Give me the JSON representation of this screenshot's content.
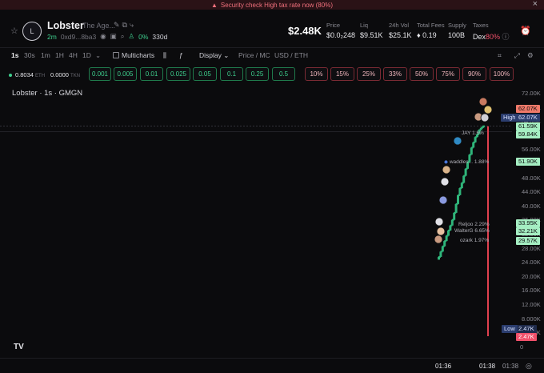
{
  "banner": {
    "text": "Security check High tax rate now (80%)",
    "close": "×"
  },
  "token": {
    "avatar_letter": "L",
    "name": "Lobster",
    "subtitle": "The Age...",
    "age": "2m",
    "address": "0xd9...8ba3",
    "holders_pct": "0%",
    "holders_count": "330d",
    "price_big": "$2.48K"
  },
  "stats": {
    "price": {
      "label": "Price",
      "value": "$0.0₂248"
    },
    "liq": {
      "label": "Liq",
      "value": "$9.51K"
    },
    "vol": {
      "label": "24h Vol",
      "value": "$25.1K"
    },
    "fees": {
      "label": "Total Fees",
      "value": "0.19"
    },
    "supply": {
      "label": "Supply",
      "value": "100B"
    },
    "taxes": {
      "label": "Taxes",
      "value_prefix": "Dex",
      "value_pct": "80%"
    }
  },
  "toolbar": {
    "intervals": [
      "1s",
      "30s",
      "1m",
      "1H",
      "4H",
      "1D"
    ],
    "multicharts": "Multicharts",
    "display": "Display",
    "price_mc": "Price / MC",
    "usd_eth": "USD / ETH"
  },
  "quick": {
    "eth_balance": "0.8034",
    "eth_unit": "ETH",
    "tkn_balance": "0.0000",
    "tkn_unit": "TKN",
    "buy": [
      "0.001",
      "0.005",
      "0.01",
      "0.025",
      "0.05",
      "0.1",
      "0.25",
      "0.5"
    ],
    "sell": [
      "10%",
      "15%",
      "25%",
      "33%",
      "50%",
      "75%",
      "90%",
      "100%"
    ]
  },
  "chart_data": {
    "type": "candlestick",
    "title": "Lobster · 1s · GMGN",
    "y_ticks": [
      "72.00K",
      "68.00K",
      "64.00K",
      "60.00K",
      "56.00K",
      "52.00K",
      "48.00K",
      "44.00K",
      "40.00K",
      "36.00K",
      "32.00K",
      "28.00K",
      "24.00K",
      "20.00K",
      "16.00K",
      "12.00K",
      "8.000K",
      "4.000K",
      "0"
    ],
    "price_tags": [
      {
        "value": "62.07K",
        "style": "o"
      },
      {
        "value": "62.07K",
        "style": "b"
      },
      {
        "value": "61.59K",
        "style": "g"
      },
      {
        "value": "59.84K",
        "style": "g"
      },
      {
        "value": "51.90K",
        "style": "g"
      },
      {
        "value": "33.95K",
        "style": "g"
      },
      {
        "value": "32.21K",
        "style": "g"
      },
      {
        "value": "29.57K",
        "style": "g"
      },
      {
        "value": "2.47K",
        "style": "n"
      },
      {
        "value": "2.47K",
        "style": "r"
      }
    ],
    "high_label": "High",
    "low_label": "Low",
    "annotations": [
      "waddles... 1.88%",
      "Reljoo 2.29%",
      "WalterG 6.65%",
      "ozark 1.97%",
      "JAY 1.6%"
    ],
    "x_ticks": [
      "01:36",
      "01:38",
      "01:38"
    ],
    "candles_approx": [
      25000,
      26500,
      28000,
      29500,
      31000,
      32500,
      33900,
      35500,
      37500,
      40000,
      42500,
      44500,
      46000,
      48000,
      50000,
      51900,
      54000,
      56000,
      57500,
      59000,
      59800,
      61000,
      61600,
      62070
    ],
    "last_close": 2470,
    "tradingview_logo": "TV"
  }
}
